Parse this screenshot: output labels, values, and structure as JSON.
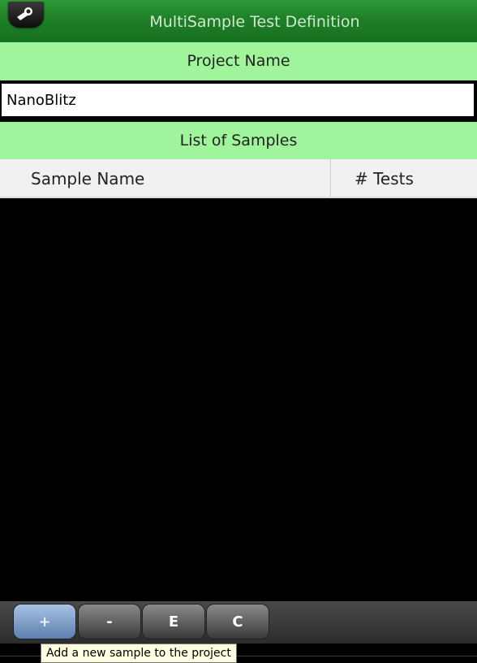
{
  "window": {
    "title": "MultiSample Test Definition"
  },
  "project": {
    "label": "Project Name",
    "name_value": "NanoBlitz"
  },
  "samples": {
    "label": "List of Samples",
    "columns": [
      "Sample Name",
      "# Tests"
    ],
    "rows": []
  },
  "toolbar": {
    "add_label": "+",
    "remove_label": "-",
    "edit_label": "E",
    "copy_label": "C"
  },
  "tooltip": {
    "text": "Add a new sample to the project"
  },
  "icons": {
    "settings": "wrench-icon"
  }
}
